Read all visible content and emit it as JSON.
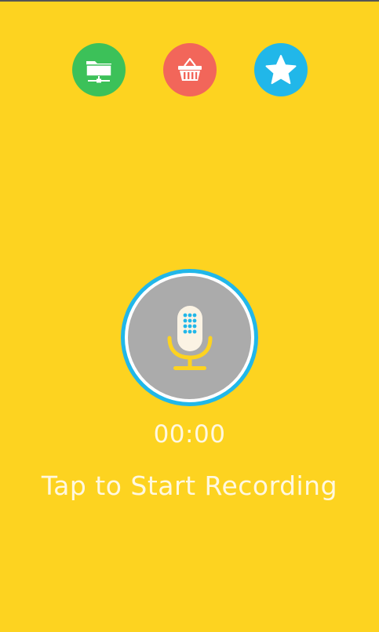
{
  "colors": {
    "background": "#FDD320",
    "files_button": "#3CC159",
    "store_button": "#F2665A",
    "favorites_button": "#21B7E9",
    "record_ring": "#21B7E9",
    "record_face": "#ABABAB",
    "mic_base": "#FDD320",
    "text": "#FFF8E0"
  },
  "toolbar": {
    "files_icon": "folder-network-icon",
    "store_icon": "shopping-basket-icon",
    "favorites_icon": "star-icon"
  },
  "recorder": {
    "icon": "microphone-icon",
    "timer": "00:00",
    "hint": "Tap to Start Recording"
  }
}
